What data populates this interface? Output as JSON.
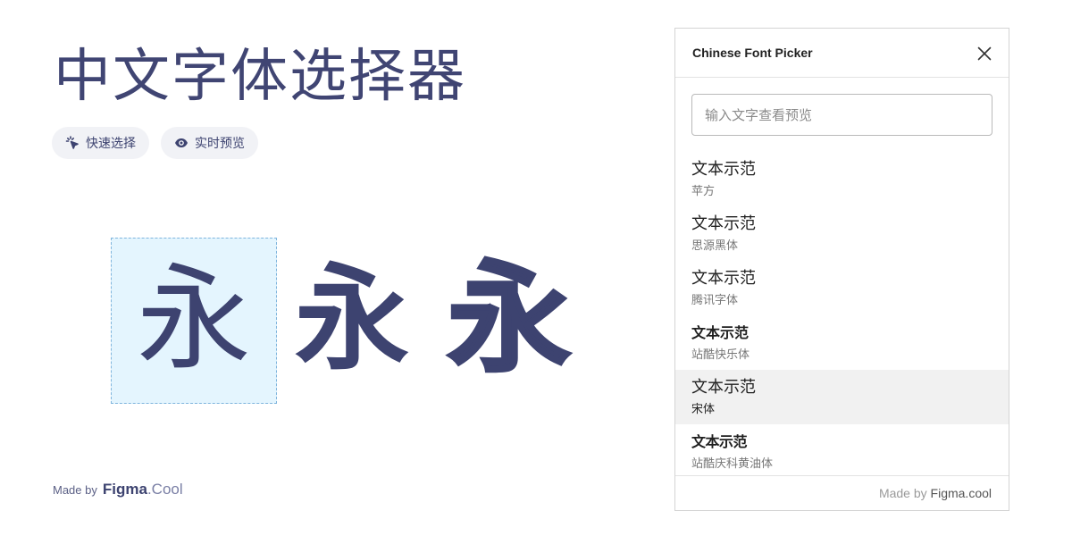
{
  "hero": {
    "title": "中文字体选择器",
    "features": [
      {
        "label": "快速选择",
        "icon": "cursor-click-icon"
      },
      {
        "label": "实时预览",
        "icon": "eye-icon"
      }
    ],
    "glyph": "永"
  },
  "made_by": {
    "prefix": "Made by",
    "brand": "Figma",
    "tld": ".Cool"
  },
  "panel": {
    "title": "Chinese Font Picker",
    "close_icon": "close-icon",
    "search": {
      "placeholder": "输入文字查看预览",
      "value": ""
    },
    "fonts": [
      {
        "sample": "文本示范",
        "name": "苹方",
        "selected": false
      },
      {
        "sample": "文本示范",
        "name": "思源黑体",
        "selected": false
      },
      {
        "sample": "文本示范",
        "name": "腾讯字体",
        "selected": false
      },
      {
        "sample": "文本示范",
        "name": "站酷快乐体",
        "selected": false
      },
      {
        "sample": "文本示范",
        "name": "宋体",
        "selected": true
      },
      {
        "sample": "文本示范",
        "name": "站酷庆科黄油体",
        "selected": false
      }
    ],
    "footer": {
      "prefix": "Made by",
      "brand": "Figma.cool"
    }
  },
  "colors": {
    "accent": "#404573",
    "preview_box_bg": "#e4f5fe",
    "preview_box_border": "#7fb5dd",
    "pill_bg": "#f1f2f6",
    "selected_row_bg": "#f1f1f1"
  }
}
